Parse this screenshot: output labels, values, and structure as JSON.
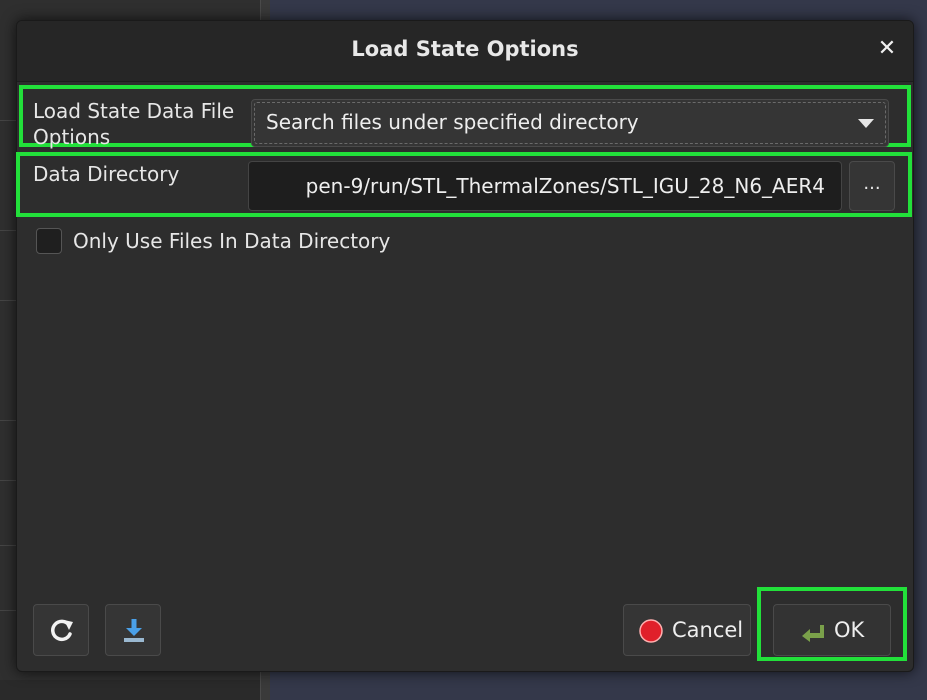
{
  "dialog": {
    "title": "Load State Options",
    "close_glyph": "✕"
  },
  "form": {
    "data_file_options_label": "Load State Data File Options",
    "data_file_options_value": "Search files under specified directory",
    "data_directory_label": "Data Directory",
    "data_directory_value": "pen-9/run/STL_ThermalZones/STL_IGU_28_N6_AER4",
    "browse_label": "...",
    "only_use_files_label": "Only Use Files In Data Directory",
    "only_use_files_checked": false
  },
  "footer": {
    "reset_icon": "refresh-icon",
    "save_icon": "download-icon",
    "cancel_label": "Cancel",
    "ok_label": "OK"
  },
  "colors": {
    "highlight": "#22e03a",
    "cancel_icon": "#e0202a",
    "ok_icon": "#7aa04a",
    "save_icon": "#4aa0e8"
  }
}
